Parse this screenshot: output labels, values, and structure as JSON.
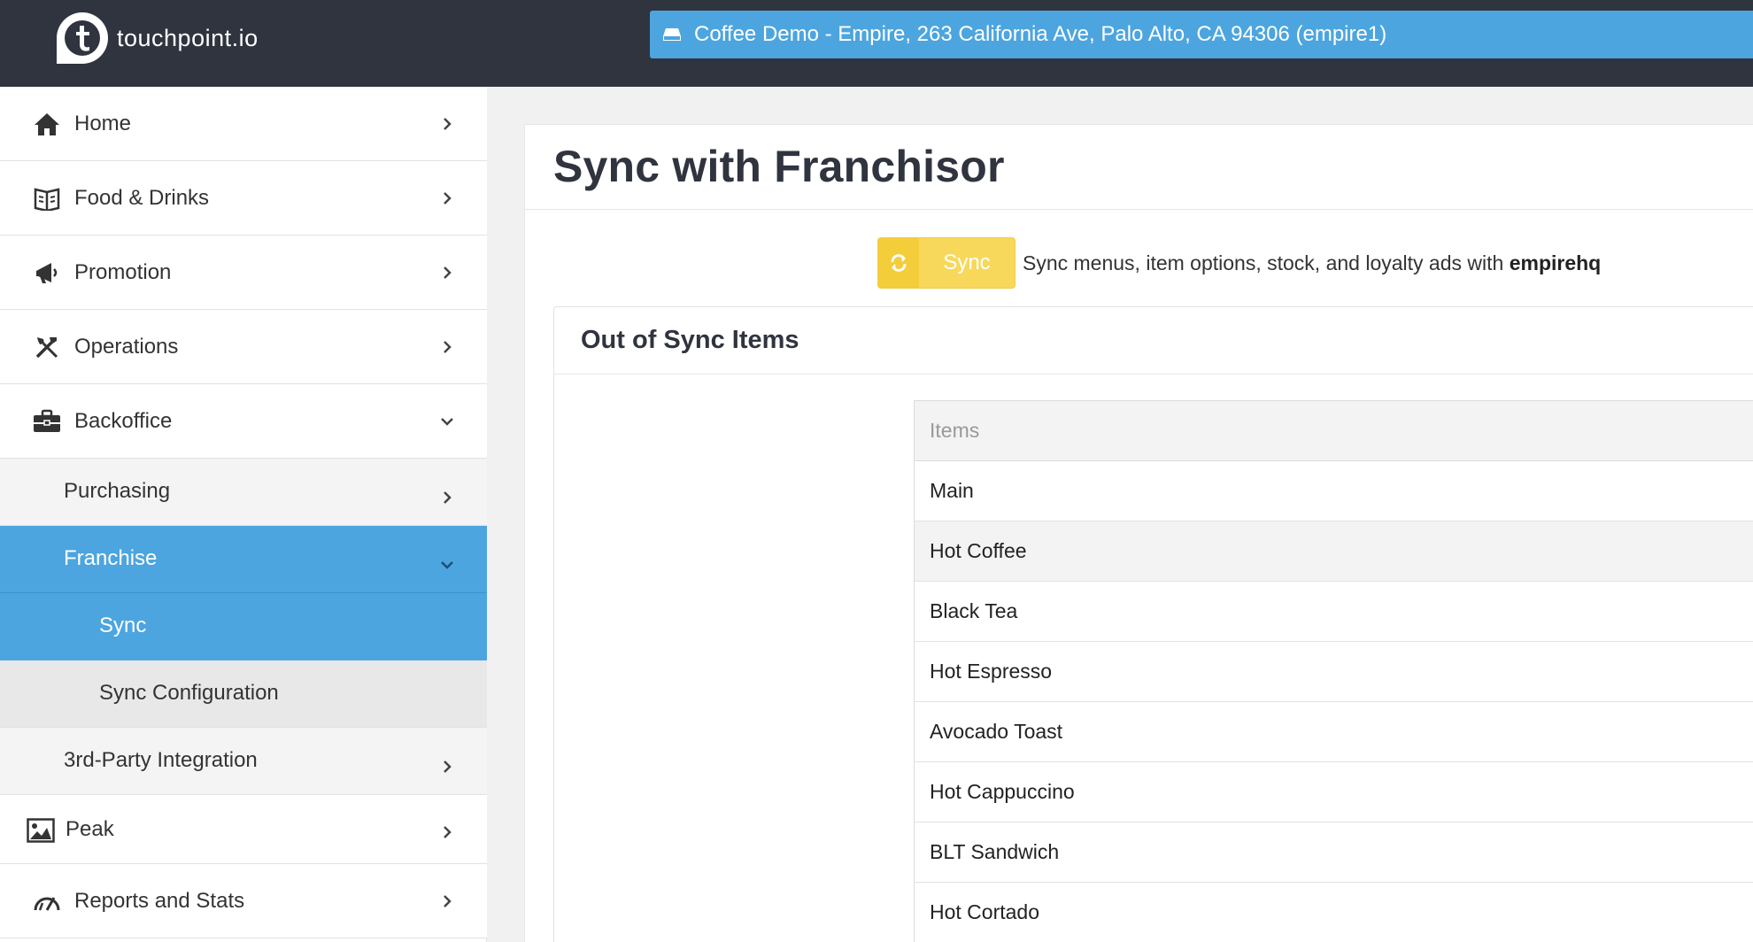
{
  "header": {
    "logo_text": "touchpoint.io",
    "store_label": "Coffee Demo - Empire, 263 California Ave, Palo Alto, CA 94306 (empire1)"
  },
  "sidebar": {
    "items": [
      {
        "label": "Home",
        "icon": "home-icon"
      },
      {
        "label": "Food & Drinks",
        "icon": "book-icon"
      },
      {
        "label": "Promotion",
        "icon": "megaphone-icon"
      },
      {
        "label": "Operations",
        "icon": "tools-icon"
      },
      {
        "label": "Backoffice",
        "icon": "briefcase-icon"
      },
      {
        "label": "Purchasing"
      },
      {
        "label": "Franchise"
      },
      {
        "label": "Sync"
      },
      {
        "label": "Sync Configuration"
      },
      {
        "label": "3rd-Party Integration"
      },
      {
        "label": "Peak",
        "icon": "image-icon"
      },
      {
        "label": "Reports and Stats",
        "icon": "gauge-icon"
      }
    ]
  },
  "main": {
    "title": "Sync with Franchisor",
    "sync_button_label": "Sync",
    "sync_description_prefix": "Sync menus, item options, stock, and loyalty ads with ",
    "sync_description_target": "empirehq",
    "out_of_sync_title": "Out of Sync Items",
    "table_header": "Items",
    "items": [
      "Main",
      "Hot Coffee",
      "Black Tea",
      "Hot Espresso",
      "Avocado Toast",
      "Hot Cappuccino",
      "BLT Sandwich",
      "Hot Cortado"
    ]
  },
  "colors": {
    "topbar": "#2f343f",
    "accent": "#4ca5df",
    "sync_button": "#f7d85b"
  }
}
